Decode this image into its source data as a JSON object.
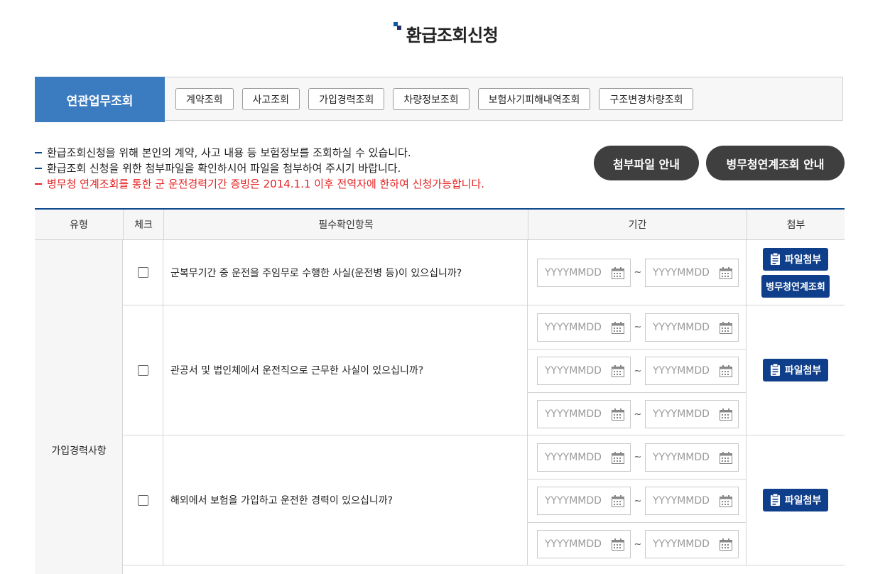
{
  "page": {
    "title": "환급조회신청"
  },
  "related": {
    "heading": "연관업무조회",
    "buttons": [
      "계약조회",
      "사고조회",
      "가입경력조회",
      "차량정보조회",
      "보험사기피해내역조회",
      "구조변경차량조회"
    ]
  },
  "notes": [
    {
      "text": "환급조회신청을 위해 본인의 계약, 사고 내용 등 보험정보를 조회하실 수 있습니다.",
      "color": "#222222"
    },
    {
      "text": "환급조회 신청을 위한 첨부파일을 확인하시어 파일을 첨부하여 주시기 바랍니다.",
      "color": "#222222"
    },
    {
      "text": "병무청 연계조회를 통한 군 운전경력기간 증빙은 2014.1.1 이후 전역자에 한하여 신청가능합니다.",
      "color": "#e42222"
    }
  ],
  "guides": {
    "attachment_guide": "첨부파일 안내",
    "mma_guide": "병무청연계조회 안내"
  },
  "table": {
    "headers": {
      "type": "유형",
      "check": "체크",
      "item": "필수확인항목",
      "period": "기간",
      "attach": "첨부"
    },
    "type_label": "가입경력사항",
    "date_placeholder": "YYYYMMDD",
    "tilde": "~",
    "rows": [
      {
        "question": "군복무기간 중 운전을 주임무로 수행한 사실(운전병 등)이 있으십니까?",
        "attach_label": "파일첨부",
        "extra_label": "병무청연계조회"
      },
      {
        "question": "관공서 및 법인체에서 운전직으로 근무한 사실이 있으십니까?",
        "attach_label": "파일첨부"
      },
      {
        "question": "해외에서 보험을 가입하고 운전한 경력이 있으십니까?",
        "attach_label": "파일첨부"
      }
    ]
  },
  "colors": {
    "accent": "#3b7cc0",
    "navy": "#0f3f8a",
    "dark_pill": "#3f3f3f",
    "warning": "#e42222"
  }
}
